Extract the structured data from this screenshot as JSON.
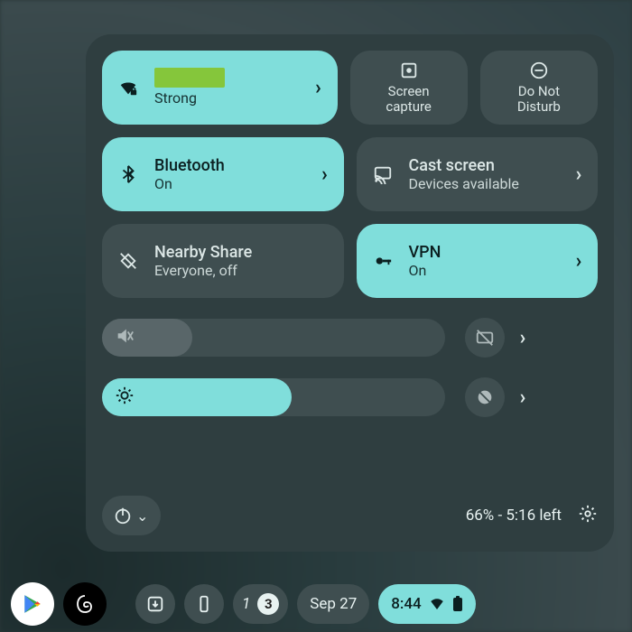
{
  "tiles": {
    "wifi": {
      "title": "",
      "sub": "Strong"
    },
    "screencap": {
      "label": "Screen\ncapture"
    },
    "dnd": {
      "label": "Do Not\nDisturb"
    },
    "bt": {
      "title": "Bluetooth",
      "sub": "On"
    },
    "cast": {
      "title": "Cast screen",
      "sub": "Devices available"
    },
    "nearby": {
      "title": "Nearby Share",
      "sub": "Everyone, off"
    },
    "vpn": {
      "title": "VPN",
      "sub": "On"
    }
  },
  "battery": {
    "text": "66% - 5:16 left"
  },
  "shelf": {
    "notif_priority": "1",
    "notif_count": "3",
    "date": "Sep 27",
    "clock": "8:44"
  }
}
